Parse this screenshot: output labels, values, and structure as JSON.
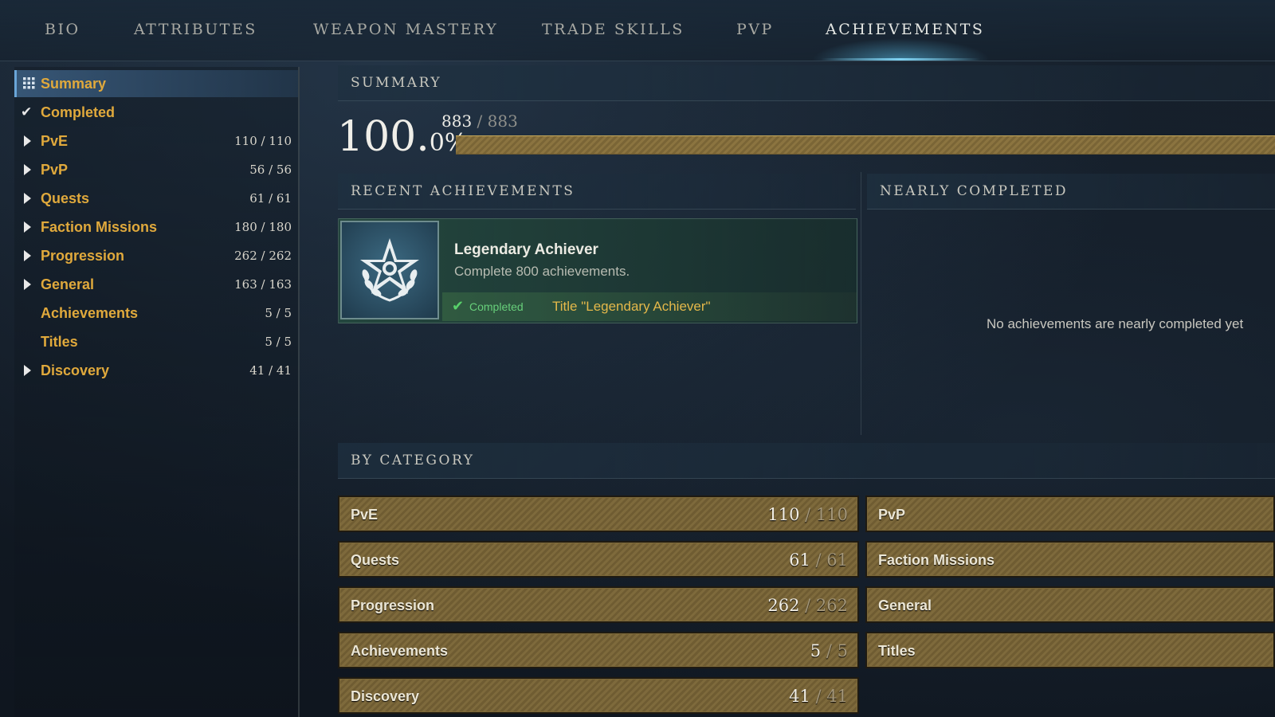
{
  "tabs": [
    {
      "label": "BIO"
    },
    {
      "label": "ATTRIBUTES"
    },
    {
      "label": "WEAPON MASTERY"
    },
    {
      "label": "TRADE SKILLS"
    },
    {
      "label": "PVP"
    },
    {
      "label": "ACHIEVEMENTS",
      "active": true
    }
  ],
  "sidebar": {
    "items": [
      {
        "label": "Summary",
        "icon": "grid-icon",
        "selected": true
      },
      {
        "label": "Completed",
        "icon": "check-icon"
      },
      {
        "label": "PvE",
        "icon": "triangle-right-icon",
        "count": "110 / 110"
      },
      {
        "label": "PvP",
        "icon": "triangle-right-icon",
        "count": "56 / 56"
      },
      {
        "label": "Quests",
        "icon": "triangle-right-icon",
        "count": "61 / 61"
      },
      {
        "label": "Faction Missions",
        "icon": "triangle-right-icon",
        "count": "180 / 180"
      },
      {
        "label": "Progression",
        "icon": "triangle-right-icon",
        "count": "262 / 262"
      },
      {
        "label": "General",
        "icon": "triangle-right-icon",
        "count": "163 / 163"
      },
      {
        "label": "Achievements",
        "count": "5 / 5"
      },
      {
        "label": "Titles",
        "count": "5 / 5"
      },
      {
        "label": "Discovery",
        "icon": "triangle-right-icon",
        "count": "41 / 41"
      }
    ]
  },
  "summary": {
    "header": "SUMMARY",
    "percent_main": "100.",
    "percent_decimal": "0%",
    "completed": "883",
    "separator": "/",
    "total": "883",
    "progress_fraction": 1.0
  },
  "recent": {
    "header": "RECENT ACHIEVEMENTS",
    "card": {
      "icon": "star-laurel-emblem-icon",
      "title": "Legendary Achiever",
      "description": "Complete 800 achievements.",
      "status": "Completed",
      "reward": "Title \"Legendary Achiever\""
    }
  },
  "nearly": {
    "header": "NEARLY COMPLETED",
    "empty_text": "No achievements are nearly completed yet"
  },
  "by_category": {
    "header": "BY CATEGORY",
    "left": [
      {
        "label": "PvE",
        "current": "110",
        "total": "110"
      },
      {
        "label": "Quests",
        "current": "61",
        "total": "61"
      },
      {
        "label": "Progression",
        "current": "262",
        "total": "262"
      },
      {
        "label": "Achievements",
        "current": "5",
        "total": "5"
      },
      {
        "label": "Discovery",
        "current": "41",
        "total": "41"
      }
    ],
    "right": [
      {
        "label": "PvP"
      },
      {
        "label": "Faction Missions"
      },
      {
        "label": "General"
      },
      {
        "label": "Titles"
      }
    ]
  },
  "colors": {
    "accent_gold": "#e0a93c",
    "bar_gold": "#8b7440",
    "completed_green": "#58d06a",
    "selected_blue": "#3c5f82"
  }
}
